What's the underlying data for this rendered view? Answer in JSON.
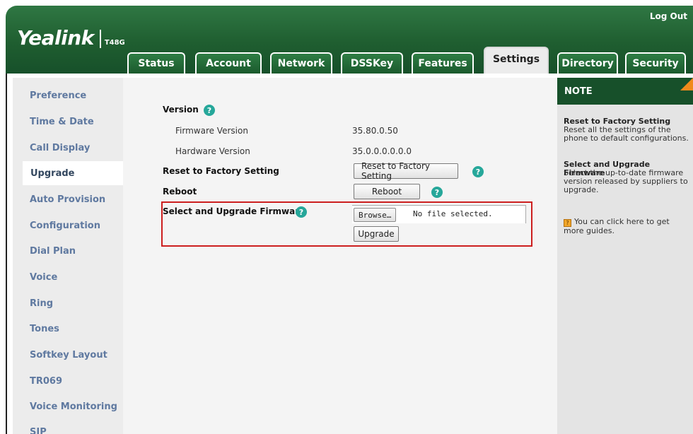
{
  "header": {
    "logo_text": "Yealink",
    "model": "T48G",
    "logout": "Log Out"
  },
  "tabs": [
    {
      "label": "Status"
    },
    {
      "label": "Account"
    },
    {
      "label": "Network"
    },
    {
      "label": "DSSKey"
    },
    {
      "label": "Features"
    },
    {
      "label": "Settings",
      "active": true
    },
    {
      "label": "Directory"
    },
    {
      "label": "Security"
    }
  ],
  "sidebar": {
    "items": [
      {
        "label": "Preference"
      },
      {
        "label": "Time & Date"
      },
      {
        "label": "Call Display"
      },
      {
        "label": "Upgrade",
        "active": true
      },
      {
        "label": "Auto Provision"
      },
      {
        "label": "Configuration"
      },
      {
        "label": "Dial Plan"
      },
      {
        "label": "Voice"
      },
      {
        "label": "Ring"
      },
      {
        "label": "Tones"
      },
      {
        "label": "Softkey Layout"
      },
      {
        "label": "TR069"
      },
      {
        "label": "Voice Monitoring"
      },
      {
        "label": "SIP"
      }
    ]
  },
  "main": {
    "version_label": "Version",
    "firmware_version_label": "Firmware Version",
    "firmware_version_value": "35.80.0.50",
    "hardware_version_label": "Hardware Version",
    "hardware_version_value": "35.0.0.0.0.0.0",
    "reset_label": "Reset to Factory Setting",
    "reset_button": "Reset to Factory Setting",
    "reboot_label": "Reboot",
    "reboot_button": "Reboot",
    "upgrade_label": "Select and Upgrade Firmware",
    "browse_button": "Browse…",
    "file_status": "No file selected.",
    "upgrade_button": "Upgrade",
    "help_glyph": "?"
  },
  "note": {
    "title": "NOTE",
    "reset_title": "Reset to Factory Setting",
    "reset_text": "Reset all the settings of the phone to default configurations.",
    "upgrade_title": "Select and Upgrade Firmware",
    "upgrade_text": "Select the up-to-date firmware version released by suppliers to upgrade.",
    "guide_text": "You can click here to get more guides."
  },
  "colors": {
    "header_green": "#17502a",
    "sidebar_link": "#5f79a0",
    "help_icon": "#26a79a",
    "highlight_border": "#cc1f1f",
    "note_corner": "#f08a1c"
  }
}
